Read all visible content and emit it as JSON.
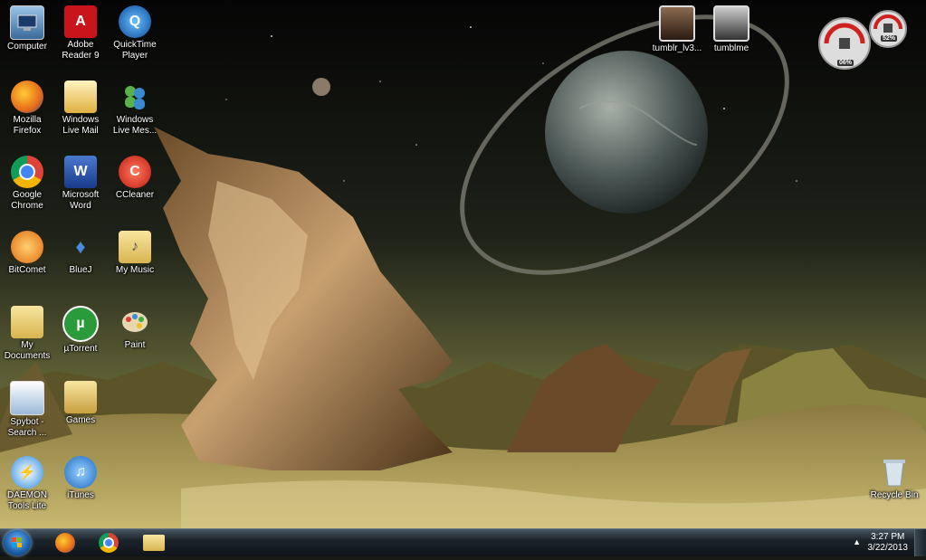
{
  "desktop": {
    "icons": [
      {
        "label": "Computer",
        "icon": "computer-icon"
      },
      {
        "label": "Adobe Reader 9",
        "icon": "adobe-reader-icon"
      },
      {
        "label": "QuickTime Player",
        "icon": "quicktime-icon"
      },
      {
        "label": "Mozilla Firefox",
        "icon": "firefox-icon"
      },
      {
        "label": "Windows Live Mail",
        "icon": "live-mail-icon"
      },
      {
        "label": "Windows Live Mes...",
        "icon": "live-messenger-icon"
      },
      {
        "label": "Google Chrome",
        "icon": "chrome-icon"
      },
      {
        "label": "Microsoft Word",
        "icon": "word-icon"
      },
      {
        "label": "CCleaner",
        "icon": "ccleaner-icon"
      },
      {
        "label": "BitComet",
        "icon": "bitcomet-icon"
      },
      {
        "label": "BlueJ",
        "icon": "bluej-icon"
      },
      {
        "label": "My Music",
        "icon": "music-folder-icon"
      },
      {
        "label": "My Documents",
        "icon": "documents-folder-icon"
      },
      {
        "label": "µTorrent",
        "icon": "utorrent-icon"
      },
      {
        "label": "Paint",
        "icon": "paint-icon"
      },
      {
        "label": "Spybot - Search ...",
        "icon": "spybot-icon"
      },
      {
        "label": "Games",
        "icon": "games-folder-icon"
      },
      {
        "label": "DAEMON Tools Lite",
        "icon": "daemon-tools-icon"
      },
      {
        "label": "iTunes",
        "icon": "itunes-icon"
      },
      {
        "label": "tumblr_lv3...",
        "icon": "image-file-icon"
      },
      {
        "label": "tumblme",
        "icon": "image-file-icon"
      },
      {
        "label": "Recycle Bin",
        "icon": "recycle-bin-icon"
      }
    ]
  },
  "gadget": {
    "cpu": "06%",
    "memory": "52%"
  },
  "taskbar": {
    "pinned": [
      "firefox-icon",
      "chrome-icon",
      "explorer-icon"
    ],
    "time": "3:27 PM",
    "date": "3/22/2013",
    "tray_arrow": "▲"
  }
}
